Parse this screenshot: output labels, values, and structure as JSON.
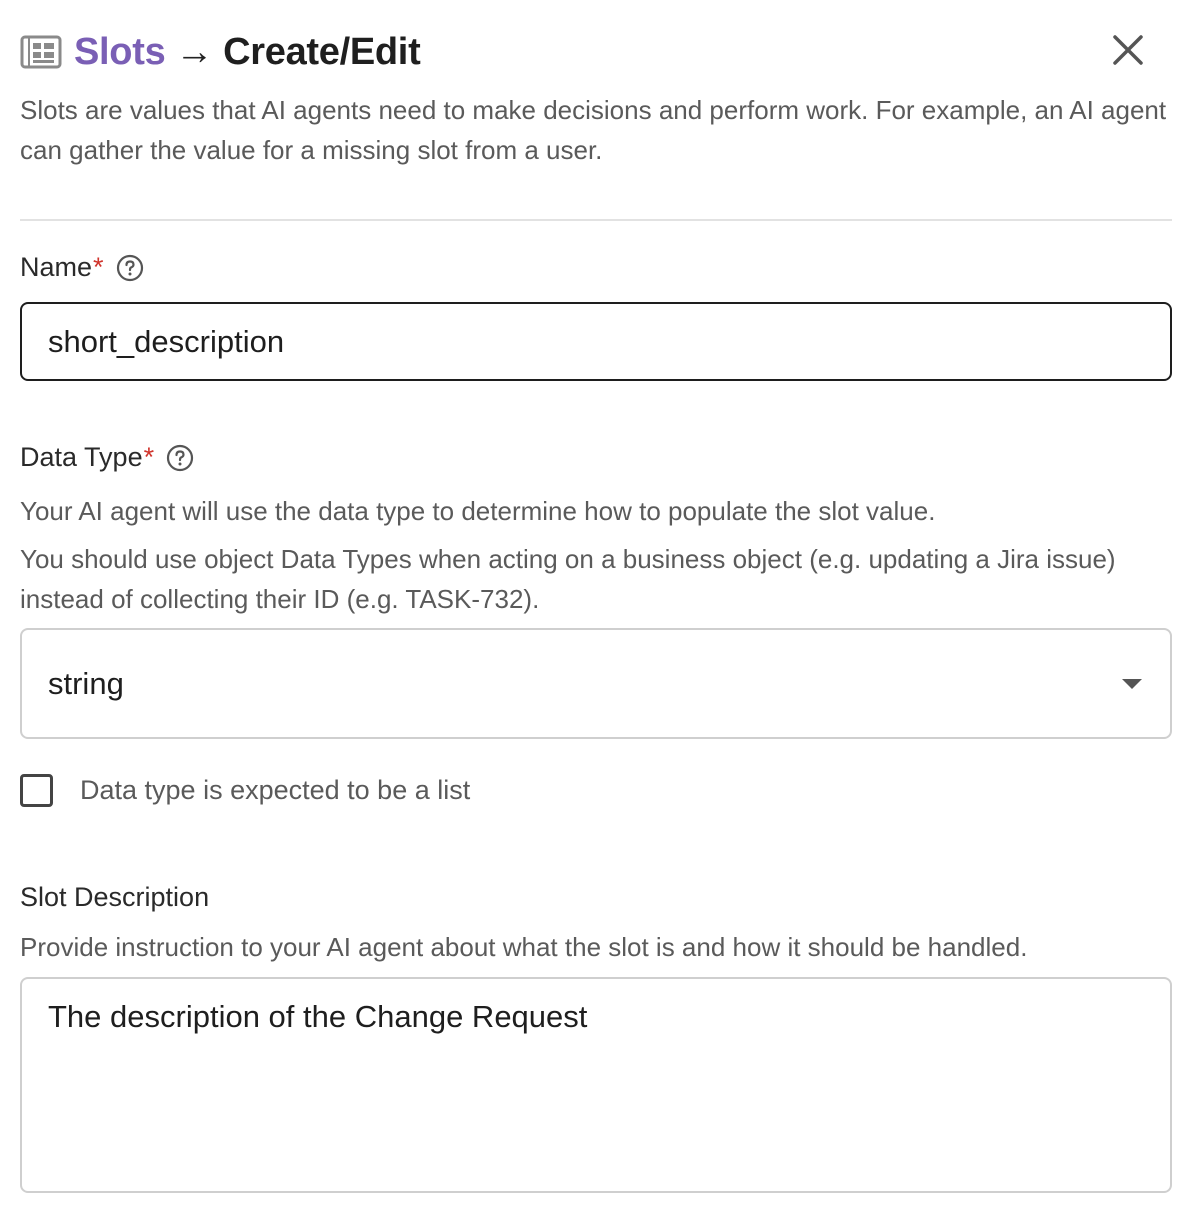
{
  "header": {
    "breadcrumb_root": "Slots",
    "arrow": "→",
    "current": "Create/Edit",
    "icon": "slot-list-icon",
    "close_icon": "close-icon",
    "accent_color": "#7a5fb5"
  },
  "intro": "Slots are values that AI agents need to make decisions and perform work. For example, an AI agent can gather the value for a missing slot from a user.",
  "name_field": {
    "label": "Name",
    "required_mark": "*",
    "help_icon": "help-circle-icon",
    "value": "short_description"
  },
  "data_type_field": {
    "label": "Data Type",
    "required_mark": "*",
    "help_icon": "help-circle-icon",
    "help_line1": "Your AI agent will use the data type to determine how to populate the slot value.",
    "help_line2": "You should use object Data Types when acting on a business object (e.g. updating a Jira issue) instead of collecting their ID (e.g. TASK-732).",
    "selected": "string",
    "caret_icon": "caret-down-icon"
  },
  "list_checkbox": {
    "label": "Data type is expected to be a list",
    "checked": false
  },
  "slot_description_field": {
    "label": "Slot Description",
    "help": "Provide instruction to your AI agent about what the slot is and how it should be handled.",
    "value": "The description of the Change Request"
  },
  "colors": {
    "required": "#d0342c",
    "secondary_text": "#5a5a5a",
    "border": "#cfcfcf",
    "divider": "#e2e2e2"
  }
}
